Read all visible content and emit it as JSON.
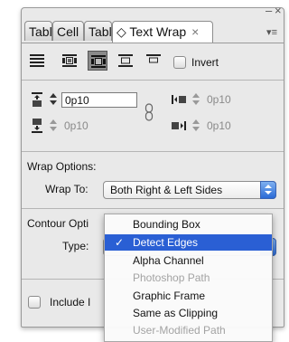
{
  "window": {
    "close_glyph": "×",
    "minimize_glyph": "–"
  },
  "tabs": [
    {
      "label": "Tabl",
      "active": false
    },
    {
      "label": "Cell",
      "active": false
    },
    {
      "label": "Tabl",
      "active": false
    },
    {
      "label": "◇ Text Wrap",
      "active": true,
      "close": "×"
    }
  ],
  "panel_menu_icon": "panel-menu-icon",
  "wrap_buttons": [
    {
      "name": "no-text-wrap-icon",
      "selected": false
    },
    {
      "name": "wrap-around-bounding-box-icon",
      "selected": false
    },
    {
      "name": "wrap-around-object-shape-icon",
      "selected": true
    },
    {
      "name": "jump-object-icon",
      "selected": false
    },
    {
      "name": "jump-to-next-column-icon",
      "selected": false
    }
  ],
  "invert": {
    "label": "Invert",
    "checked": false
  },
  "offsets": {
    "top": {
      "value": "0p10",
      "enabled": true
    },
    "bottom": {
      "value": "0p10",
      "enabled": false
    },
    "left": {
      "value": "0p10",
      "enabled": false
    },
    "right": {
      "value": "0p10",
      "enabled": false
    }
  },
  "wrap_options": {
    "heading": "Wrap Options:",
    "wrap_to_label": "Wrap To:",
    "wrap_to_value": "Both Right & Left Sides"
  },
  "contour_options": {
    "heading": "Contour Opti",
    "type_label": "Type:"
  },
  "include_inside": {
    "label": "Include I",
    "checked": false
  },
  "type_menu": {
    "items": [
      {
        "label": "Bounding Box",
        "state": "normal"
      },
      {
        "label": "Detect Edges",
        "state": "selected",
        "check": "✓"
      },
      {
        "label": "Alpha Channel",
        "state": "normal"
      },
      {
        "label": "Photoshop Path",
        "state": "disabled"
      },
      {
        "label": "Graphic Frame",
        "state": "normal"
      },
      {
        "label": "Same as Clipping",
        "state": "normal"
      },
      {
        "label": "User-Modified Path",
        "state": "disabled"
      }
    ]
  },
  "colors": {
    "highlight": "#2a5fd4",
    "panel": "#e9e9e9"
  }
}
